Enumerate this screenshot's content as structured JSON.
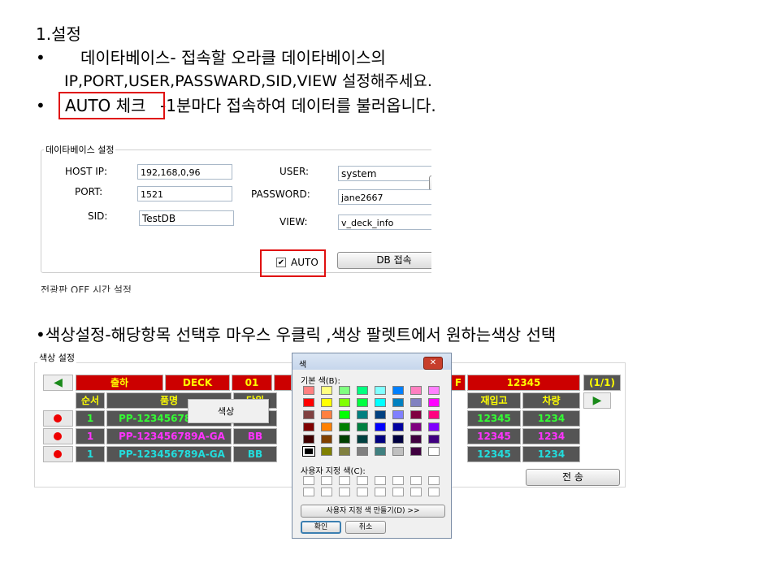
{
  "slide": {
    "heading": "1.설정",
    "bullet1_line1": "데이타베이스- 접속할 오라클 데이타베이스의",
    "bullet1_line2": "IP,PORT,USER,PASSWARD,SID,VIEW 설정해주세요.",
    "bullet2_auto": "AUTO 체크",
    "bullet2_rest": "-1분마다 접속하여 데이터를 불러옵니다.",
    "bullet3": "•색상설정-해당항목 선택후 마우스 우클릭 ,색상 팔렛트에서 원하는색상 선택",
    "bullet_char": "•"
  },
  "db_settings": {
    "legend": "데이타베이스 설정",
    "host_ip_label": "HOST IP:",
    "host_ip": "192,168,0,96",
    "port_label": "PORT:",
    "port": "1521",
    "sid_label": "SID:",
    "sid": "TestDB",
    "user_label": "USER:",
    "user": "system",
    "password_label": "PASSWORD:",
    "password": "jane2667",
    "view_label": "VIEW:",
    "view": "v_deck_info",
    "auto_label": "AUTO",
    "auto_checked": true,
    "connect_button": "DB 접속",
    "next_section_cut": "전광판 OFF 시간 설정"
  },
  "color_settings": {
    "legend": "색상 설정",
    "header_row": {
      "left_arrow": "◀",
      "c1": "출하",
      "c2": "DECK",
      "c3": "01",
      "c4": "F",
      "c5": "12345",
      "page": "(1/1)"
    },
    "col_headers": {
      "seq": "순서",
      "product": "품명",
      "unit": "단위",
      "stock": "재입고",
      "vehicle": "차량",
      "right_arrow": "▶"
    },
    "rows": [
      {
        "seq": "1",
        "product": "PP-12345678",
        "unit": "",
        "stock": "12345",
        "vehicle": "1234",
        "color": "#33ff33"
      },
      {
        "seq": "1",
        "product": "PP-123456789A-GA",
        "unit": "BB",
        "stock": "12345",
        "vehicle": "1234",
        "color": "#ff33ff"
      },
      {
        "seq": "1",
        "product": "PP-123456789A-GA",
        "unit": "BB",
        "stock": "12345",
        "vehicle": "1234",
        "color": "#22dddd"
      }
    ],
    "send_button": "전 송",
    "context_menu_item": "색상"
  },
  "color_dialog": {
    "title": "색",
    "close": "✕",
    "basic_colors_label": "기본 색(B):",
    "basic_colors": [
      "#ff8080",
      "#ffff80",
      "#80ff80",
      "#00ff80",
      "#80ffff",
      "#0080ff",
      "#ff80c0",
      "#ff80ff",
      "#ff0000",
      "#ffff00",
      "#80ff00",
      "#00ff40",
      "#00ffff",
      "#0080c0",
      "#8080c0",
      "#ff00ff",
      "#804040",
      "#ff8040",
      "#00ff00",
      "#008080",
      "#004080",
      "#8080ff",
      "#800040",
      "#ff0080",
      "#800000",
      "#ff8000",
      "#008000",
      "#008040",
      "#0000ff",
      "#0000a0",
      "#800080",
      "#8000ff",
      "#400000",
      "#804000",
      "#004000",
      "#004040",
      "#000080",
      "#000040",
      "#400040",
      "#400080",
      "#000000",
      "#808000",
      "#808040",
      "#808080",
      "#408080",
      "#c0c0c0",
      "#400040",
      "#ffffff"
    ],
    "custom_colors_label": "사용자 지정 색(C):",
    "define_custom_button": "사용자 지정 색 만들기(D) >>",
    "ok_button": "확인",
    "cancel_button": "취소"
  }
}
